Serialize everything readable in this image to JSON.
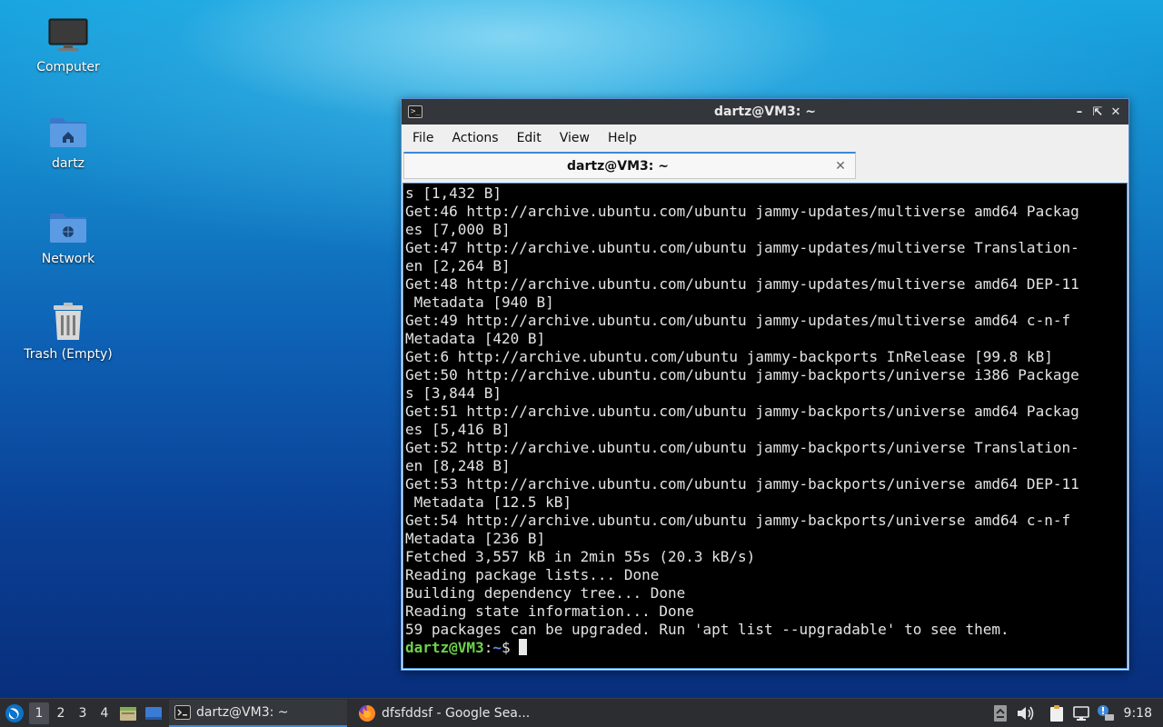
{
  "desktop": {
    "icons": [
      {
        "label": "Computer"
      },
      {
        "label": "dartz"
      },
      {
        "label": "Network"
      },
      {
        "label": "Trash (Empty)"
      }
    ]
  },
  "terminal": {
    "window_title": "dartz@VM3: ~",
    "menu": [
      "File",
      "Actions",
      "Edit",
      "View",
      "Help"
    ],
    "tab_label": "dartz@VM3: ~",
    "output": "s [1,432 B]\nGet:46 http://archive.ubuntu.com/ubuntu jammy-updates/multiverse amd64 Packag\nes [7,000 B]\nGet:47 http://archive.ubuntu.com/ubuntu jammy-updates/multiverse Translation-\nen [2,264 B]\nGet:48 http://archive.ubuntu.com/ubuntu jammy-updates/multiverse amd64 DEP-11\n Metadata [940 B]\nGet:49 http://archive.ubuntu.com/ubuntu jammy-updates/multiverse amd64 c-n-f\nMetadata [420 B]\nGet:6 http://archive.ubuntu.com/ubuntu jammy-backports InRelease [99.8 kB]\nGet:50 http://archive.ubuntu.com/ubuntu jammy-backports/universe i386 Package\ns [3,844 B]\nGet:51 http://archive.ubuntu.com/ubuntu jammy-backports/universe amd64 Packag\nes [5,416 B]\nGet:52 http://archive.ubuntu.com/ubuntu jammy-backports/universe Translation-\nen [8,248 B]\nGet:53 http://archive.ubuntu.com/ubuntu jammy-backports/universe amd64 DEP-11\n Metadata [12.5 kB]\nGet:54 http://archive.ubuntu.com/ubuntu jammy-backports/universe amd64 c-n-f\nMetadata [236 B]\nFetched 3,557 kB in 2min 55s (20.3 kB/s)\nReading package lists... Done\nBuilding dependency tree... Done\nReading state information... Done\n59 packages can be upgraded. Run 'apt list --upgradable' to see them.",
    "prompt_user": "dartz@VM3",
    "prompt_sep": ":",
    "prompt_path": "~",
    "prompt_symbol": "$ "
  },
  "taskbar": {
    "workspaces": [
      "1",
      "2",
      "3",
      "4"
    ],
    "tasks": [
      {
        "label": "dartz@VM3: ~"
      },
      {
        "label": "dfsfddsf - Google Sea..."
      }
    ],
    "clock": "9:18"
  },
  "colors": {
    "accent": "#3d88d8",
    "prompt_user": "#6dd34a",
    "prompt_path": "#5b8de6",
    "terminal_bg": "#000000",
    "titlebar_bg": "#33363b",
    "taskbar_bg": "#2b2d31"
  }
}
